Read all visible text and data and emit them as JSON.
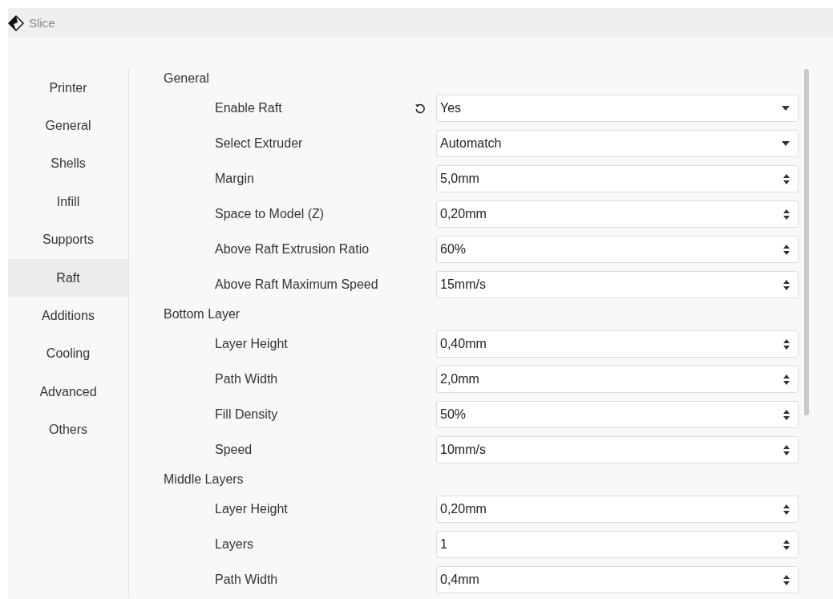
{
  "window": {
    "title": "Slice"
  },
  "sidebar": {
    "items": [
      {
        "label": "Printer",
        "selected": false
      },
      {
        "label": "General",
        "selected": false
      },
      {
        "label": "Shells",
        "selected": false
      },
      {
        "label": "Infill",
        "selected": false
      },
      {
        "label": "Supports",
        "selected": false
      },
      {
        "label": "Raft",
        "selected": true
      },
      {
        "label": "Additions",
        "selected": false
      },
      {
        "label": "Cooling",
        "selected": false
      },
      {
        "label": "Advanced",
        "selected": false
      },
      {
        "label": "Others",
        "selected": false
      }
    ]
  },
  "sections": [
    {
      "title": "General",
      "settings": [
        {
          "label": "Enable Raft",
          "kind": "select",
          "value": "Yes",
          "modified": true
        },
        {
          "label": "Select Extruder",
          "kind": "select",
          "value": "Automatch",
          "modified": false
        },
        {
          "label": "Margin",
          "kind": "spin",
          "value": "5,0mm",
          "modified": false
        },
        {
          "label": "Space to Model (Z)",
          "kind": "spin",
          "value": "0,20mm",
          "modified": false
        },
        {
          "label": "Above Raft Extrusion Ratio",
          "kind": "spin",
          "value": "60%",
          "modified": false
        },
        {
          "label": "Above Raft Maximum Speed",
          "kind": "spin",
          "value": "15mm/s",
          "modified": false
        }
      ]
    },
    {
      "title": "Bottom Layer",
      "settings": [
        {
          "label": "Layer Height",
          "kind": "spin",
          "value": "0,40mm",
          "modified": false
        },
        {
          "label": "Path Width",
          "kind": "spin",
          "value": "2,0mm",
          "modified": false
        },
        {
          "label": "Fill Density",
          "kind": "spin",
          "value": "50%",
          "modified": false
        },
        {
          "label": "Speed",
          "kind": "spin",
          "value": "10mm/s",
          "modified": false
        }
      ]
    },
    {
      "title": "Middle Layers",
      "settings": [
        {
          "label": "Layer Height",
          "kind": "spin",
          "value": "0,20mm",
          "modified": false
        },
        {
          "label": "Layers",
          "kind": "spin",
          "value": "1",
          "modified": false
        },
        {
          "label": "Path Width",
          "kind": "spin",
          "value": "0,4mm",
          "modified": false
        }
      ]
    }
  ]
}
